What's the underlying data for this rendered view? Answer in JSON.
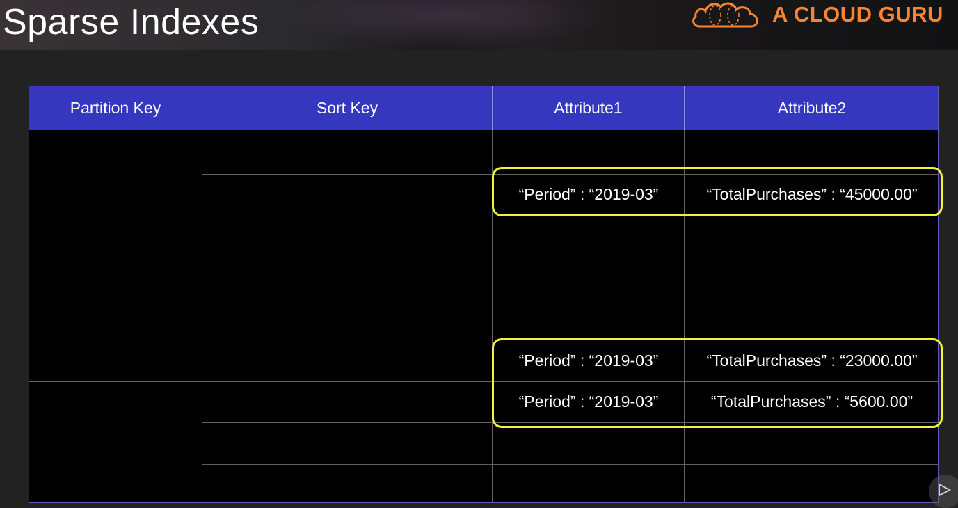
{
  "slide": {
    "title": "Sparse Indexes"
  },
  "brand": {
    "name": "A CLOUD GURU",
    "logo_icon": "cloud-logo-icon",
    "color": "#f58534"
  },
  "table": {
    "headers": [
      "Partition Key",
      "Sort Key",
      "Attribute1",
      "Attribute2"
    ],
    "header_color": "#3538bf",
    "highlight_color": "#f1f23a",
    "rows": [
      {
        "partition": "",
        "sort": "",
        "attr1": "",
        "attr2": ""
      },
      {
        "partition": "",
        "sort": "",
        "attr1": "“Period” : “2019-03”",
        "attr2": "“TotalPurchases” : “45000.00”"
      },
      {
        "partition": "",
        "sort": "",
        "attr1": "",
        "attr2": ""
      },
      {
        "partition": "",
        "sort": "",
        "attr1": "",
        "attr2": ""
      },
      {
        "partition": "",
        "sort": "",
        "attr1": "",
        "attr2": ""
      },
      {
        "partition": "",
        "sort": "",
        "attr1": "“Period” : “2019-03”",
        "attr2": "“TotalPurchases” : “23000.00”"
      },
      {
        "partition": "",
        "sort": "",
        "attr1": "“Period” : “2019-03”",
        "attr2": "“TotalPurchases” : “5600.00”"
      },
      {
        "partition": "",
        "sort": "",
        "attr1": "",
        "attr2": ""
      },
      {
        "partition": "",
        "sort": "",
        "attr1": "",
        "attr2": ""
      }
    ]
  },
  "player": {
    "play_icon": "play-icon"
  }
}
